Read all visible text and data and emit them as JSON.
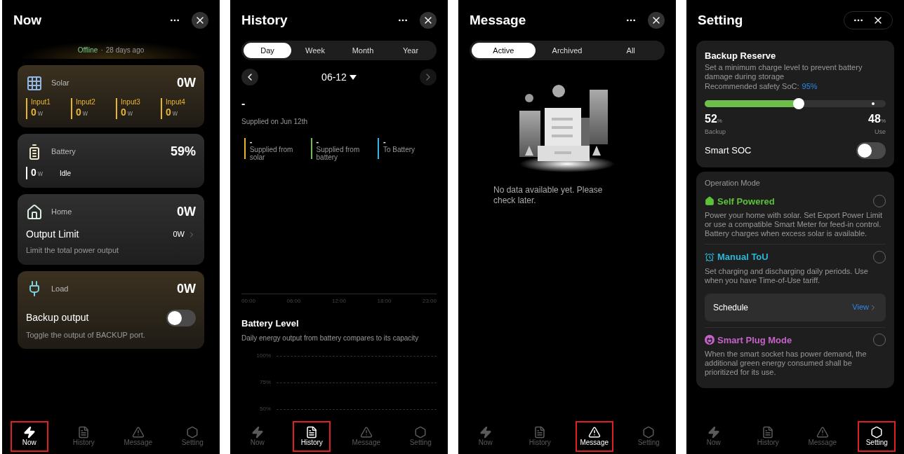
{
  "screens": [
    {
      "kind": "now",
      "title": "Now",
      "status": {
        "state": "Offline",
        "separator": "·",
        "age": "28 days ago"
      },
      "cards": [
        {
          "kind": "solar",
          "label": "Solar",
          "value": "0W",
          "inputs": [
            {
              "label": "Input1",
              "value": "0",
              "unit": "w"
            },
            {
              "label": "Input2",
              "value": "0",
              "unit": "w"
            },
            {
              "label": "Input3",
              "value": "0",
              "unit": "w"
            },
            {
              "label": "Input4",
              "value": "0",
              "unit": "w"
            }
          ]
        },
        {
          "kind": "battery",
          "label": "Battery",
          "value": "59%",
          "power": "0",
          "unit": "w",
          "state": "Idle"
        },
        {
          "kind": "home",
          "label": "Home",
          "value": "0W",
          "setting": {
            "label": "Output Limit",
            "value": "0W",
            "description": "Limit the total power output"
          }
        },
        {
          "kind": "load",
          "label": "Load",
          "value": "0W",
          "toggle": {
            "label": "Backup output",
            "on": false,
            "description": "Toggle the output of BACKUP port."
          }
        }
      ],
      "nav": [
        {
          "label": "Now",
          "selected": true
        },
        {
          "label": "History",
          "selected": false
        },
        {
          "label": "Message",
          "selected": false
        },
        {
          "label": "Setting",
          "selected": false
        }
      ]
    },
    {
      "kind": "history",
      "title": "History",
      "periods": [
        {
          "label": "Day",
          "selected": true
        },
        {
          "label": "Week",
          "selected": false
        },
        {
          "label": "Month",
          "selected": false
        },
        {
          "label": "Year",
          "selected": false
        }
      ],
      "date": "06-12",
      "total": "-",
      "total_caption": "Supplied on Jun 12th",
      "legend": [
        {
          "value": "-",
          "label": "Supplied from solar",
          "color": "#e8b62c"
        },
        {
          "value": "-",
          "label": "Supplied from battery",
          "color": "#6cc04a"
        },
        {
          "value": "-",
          "label": "To Battery",
          "color": "#3cb4e6"
        }
      ],
      "time_axis": [
        "00:00",
        "06:00",
        "12:00",
        "18:00",
        "23:00"
      ],
      "battery_level": {
        "title": "Battery Level",
        "description": "Daily energy output from battery compares to its capacity",
        "ticks": [
          "100%",
          "75%",
          "50%"
        ]
      },
      "nav": [
        {
          "label": "Now",
          "selected": false
        },
        {
          "label": "History",
          "selected": true
        },
        {
          "label": "Message",
          "selected": false
        },
        {
          "label": "Setting",
          "selected": false
        }
      ]
    },
    {
      "kind": "message",
      "title": "Message",
      "filters": [
        {
          "label": "Active",
          "selected": true
        },
        {
          "label": "Archived",
          "selected": false
        },
        {
          "label": "All",
          "selected": false
        }
      ],
      "empty_text": "No data available yet. Please check later.",
      "nav": [
        {
          "label": "Now",
          "selected": false
        },
        {
          "label": "History",
          "selected": false
        },
        {
          "label": "Message",
          "selected": true
        },
        {
          "label": "Setting",
          "selected": false
        }
      ]
    },
    {
      "kind": "setting",
      "title": "Setting",
      "backup_reserve": {
        "title": "Backup Reserve",
        "description": "Set a minimum charge level to prevent battery damage during storage",
        "recommendation": "Recommended safety SoC:",
        "recommended_value": "95%",
        "level": 0.52,
        "backup_value": "52",
        "backup_unit": "%",
        "backup_label": "Backup",
        "use_value": "48",
        "use_unit": "%",
        "use_label": "Use"
      },
      "smart_soc": {
        "label": "Smart SOC",
        "on": false
      },
      "operation_mode": {
        "title": "Operation Mode",
        "modes": [
          {
            "kind": "self",
            "label": "Self Powered",
            "color": "#5cc23a",
            "selected": false,
            "description": "Power your home with solar. Set Export Power Limit or use a compatible Smart Meter for feed-in control. Battery charges when excess solar is available."
          },
          {
            "kind": "tou",
            "label": "Manual ToU",
            "color": "#2ab8d8",
            "selected": false,
            "description": "Set charging and discharging daily periods. Use when you have Time-of-Use tariff.",
            "schedule": {
              "label": "Schedule",
              "action": "View"
            }
          },
          {
            "kind": "plug",
            "label": "Smart Plug Mode",
            "color": "#c464c8",
            "selected": false,
            "description": "When the smart socket has power demand, the additional green energy consumed shall be prioritized for its use."
          }
        ]
      },
      "nav": [
        {
          "label": "Now",
          "selected": false
        },
        {
          "label": "History",
          "selected": false
        },
        {
          "label": "Message",
          "selected": false
        },
        {
          "label": "Setting",
          "selected": true
        }
      ]
    }
  ]
}
